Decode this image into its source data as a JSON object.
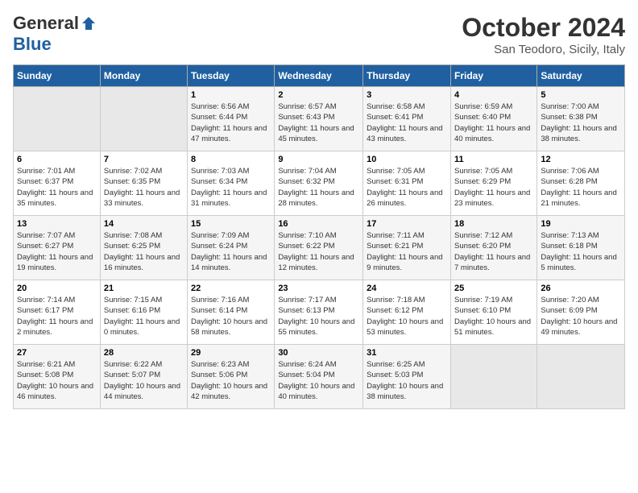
{
  "header": {
    "logo_general": "General",
    "logo_blue": "Blue",
    "month": "October 2024",
    "location": "San Teodoro, Sicily, Italy"
  },
  "days_of_week": [
    "Sunday",
    "Monday",
    "Tuesday",
    "Wednesday",
    "Thursday",
    "Friday",
    "Saturday"
  ],
  "weeks": [
    [
      {
        "day": "",
        "detail": ""
      },
      {
        "day": "",
        "detail": ""
      },
      {
        "day": "1",
        "detail": "Sunrise: 6:56 AM\nSunset: 6:44 PM\nDaylight: 11 hours and 47 minutes."
      },
      {
        "day": "2",
        "detail": "Sunrise: 6:57 AM\nSunset: 6:43 PM\nDaylight: 11 hours and 45 minutes."
      },
      {
        "day": "3",
        "detail": "Sunrise: 6:58 AM\nSunset: 6:41 PM\nDaylight: 11 hours and 43 minutes."
      },
      {
        "day": "4",
        "detail": "Sunrise: 6:59 AM\nSunset: 6:40 PM\nDaylight: 11 hours and 40 minutes."
      },
      {
        "day": "5",
        "detail": "Sunrise: 7:00 AM\nSunset: 6:38 PM\nDaylight: 11 hours and 38 minutes."
      }
    ],
    [
      {
        "day": "6",
        "detail": "Sunrise: 7:01 AM\nSunset: 6:37 PM\nDaylight: 11 hours and 35 minutes."
      },
      {
        "day": "7",
        "detail": "Sunrise: 7:02 AM\nSunset: 6:35 PM\nDaylight: 11 hours and 33 minutes."
      },
      {
        "day": "8",
        "detail": "Sunrise: 7:03 AM\nSunset: 6:34 PM\nDaylight: 11 hours and 31 minutes."
      },
      {
        "day": "9",
        "detail": "Sunrise: 7:04 AM\nSunset: 6:32 PM\nDaylight: 11 hours and 28 minutes."
      },
      {
        "day": "10",
        "detail": "Sunrise: 7:05 AM\nSunset: 6:31 PM\nDaylight: 11 hours and 26 minutes."
      },
      {
        "day": "11",
        "detail": "Sunrise: 7:05 AM\nSunset: 6:29 PM\nDaylight: 11 hours and 23 minutes."
      },
      {
        "day": "12",
        "detail": "Sunrise: 7:06 AM\nSunset: 6:28 PM\nDaylight: 11 hours and 21 minutes."
      }
    ],
    [
      {
        "day": "13",
        "detail": "Sunrise: 7:07 AM\nSunset: 6:27 PM\nDaylight: 11 hours and 19 minutes."
      },
      {
        "day": "14",
        "detail": "Sunrise: 7:08 AM\nSunset: 6:25 PM\nDaylight: 11 hours and 16 minutes."
      },
      {
        "day": "15",
        "detail": "Sunrise: 7:09 AM\nSunset: 6:24 PM\nDaylight: 11 hours and 14 minutes."
      },
      {
        "day": "16",
        "detail": "Sunrise: 7:10 AM\nSunset: 6:22 PM\nDaylight: 11 hours and 12 minutes."
      },
      {
        "day": "17",
        "detail": "Sunrise: 7:11 AM\nSunset: 6:21 PM\nDaylight: 11 hours and 9 minutes."
      },
      {
        "day": "18",
        "detail": "Sunrise: 7:12 AM\nSunset: 6:20 PM\nDaylight: 11 hours and 7 minutes."
      },
      {
        "day": "19",
        "detail": "Sunrise: 7:13 AM\nSunset: 6:18 PM\nDaylight: 11 hours and 5 minutes."
      }
    ],
    [
      {
        "day": "20",
        "detail": "Sunrise: 7:14 AM\nSunset: 6:17 PM\nDaylight: 11 hours and 2 minutes."
      },
      {
        "day": "21",
        "detail": "Sunrise: 7:15 AM\nSunset: 6:16 PM\nDaylight: 11 hours and 0 minutes."
      },
      {
        "day": "22",
        "detail": "Sunrise: 7:16 AM\nSunset: 6:14 PM\nDaylight: 10 hours and 58 minutes."
      },
      {
        "day": "23",
        "detail": "Sunrise: 7:17 AM\nSunset: 6:13 PM\nDaylight: 10 hours and 55 minutes."
      },
      {
        "day": "24",
        "detail": "Sunrise: 7:18 AM\nSunset: 6:12 PM\nDaylight: 10 hours and 53 minutes."
      },
      {
        "day": "25",
        "detail": "Sunrise: 7:19 AM\nSunset: 6:10 PM\nDaylight: 10 hours and 51 minutes."
      },
      {
        "day": "26",
        "detail": "Sunrise: 7:20 AM\nSunset: 6:09 PM\nDaylight: 10 hours and 49 minutes."
      }
    ],
    [
      {
        "day": "27",
        "detail": "Sunrise: 6:21 AM\nSunset: 5:08 PM\nDaylight: 10 hours and 46 minutes."
      },
      {
        "day": "28",
        "detail": "Sunrise: 6:22 AM\nSunset: 5:07 PM\nDaylight: 10 hours and 44 minutes."
      },
      {
        "day": "29",
        "detail": "Sunrise: 6:23 AM\nSunset: 5:06 PM\nDaylight: 10 hours and 42 minutes."
      },
      {
        "day": "30",
        "detail": "Sunrise: 6:24 AM\nSunset: 5:04 PM\nDaylight: 10 hours and 40 minutes."
      },
      {
        "day": "31",
        "detail": "Sunrise: 6:25 AM\nSunset: 5:03 PM\nDaylight: 10 hours and 38 minutes."
      },
      {
        "day": "",
        "detail": ""
      },
      {
        "day": "",
        "detail": ""
      }
    ]
  ]
}
